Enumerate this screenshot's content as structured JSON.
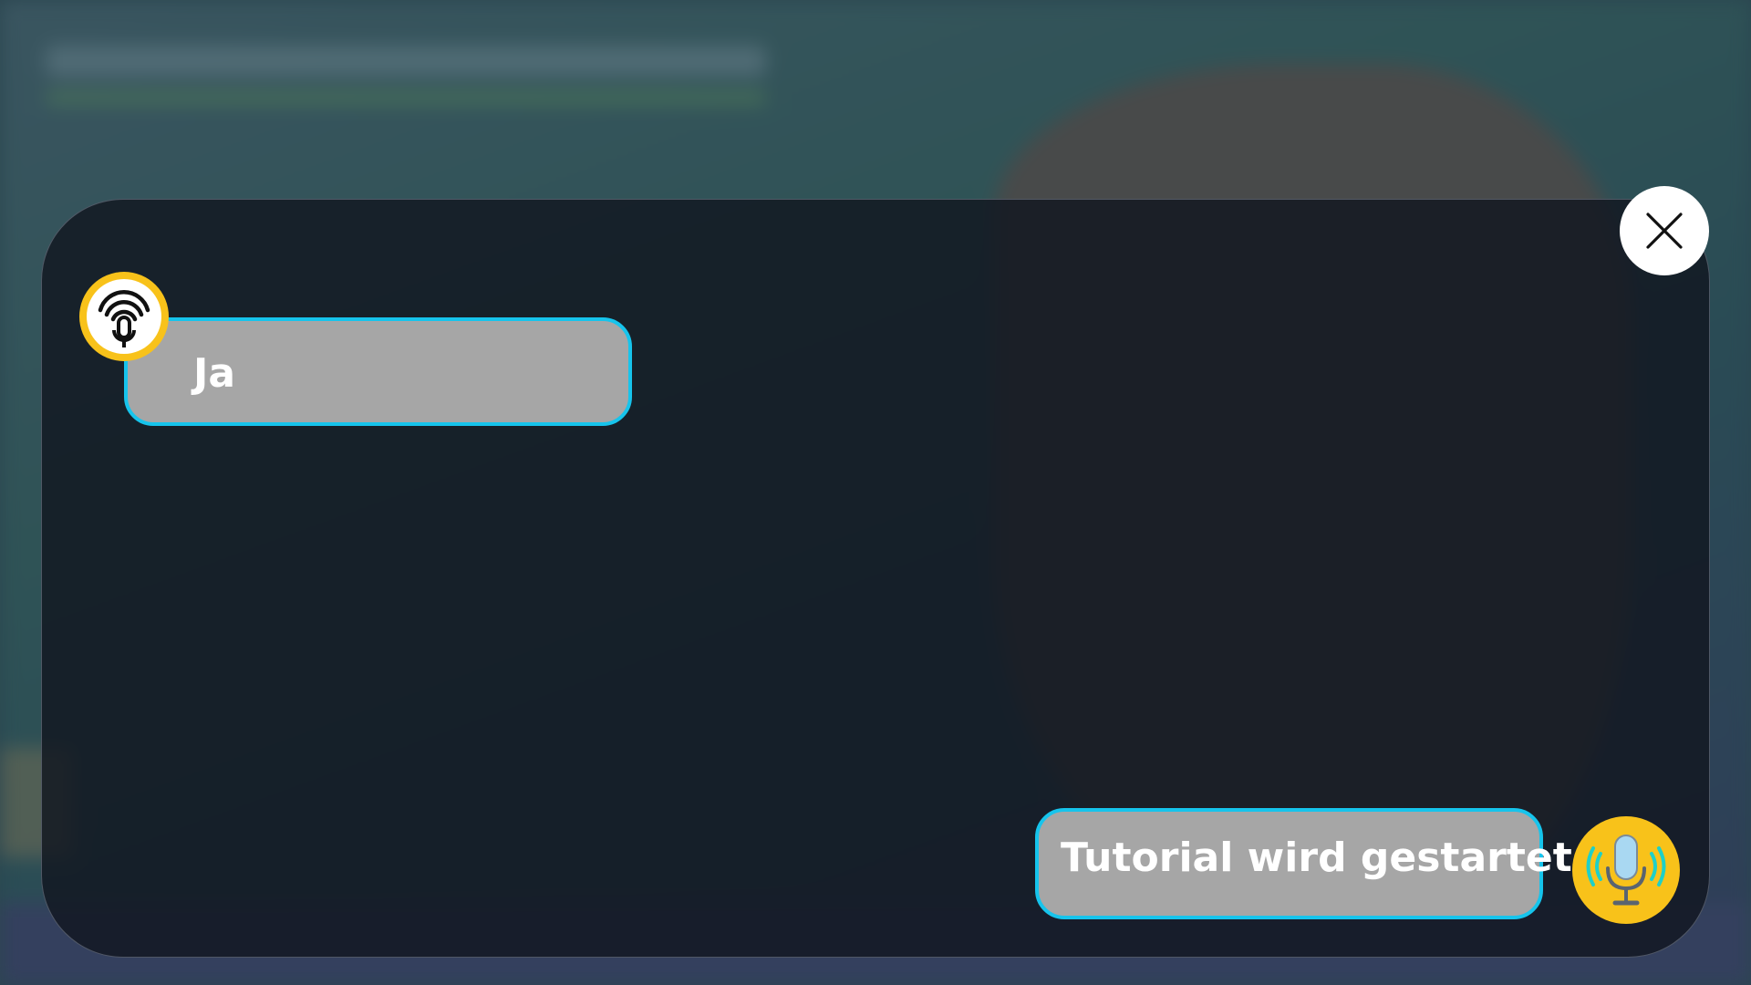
{
  "dialog": {
    "user_message": "Ja",
    "assistant_message": "Tutorial wird gestartet",
    "close_icon": "close-icon",
    "user_icon": "microphone-broadcast-icon",
    "assistant_icon": "microphone-speaking-icon"
  },
  "colors": {
    "accent_border": "#16c4ec",
    "bubble_fill": "#a6a6a6",
    "badge_yellow": "#f8c21a",
    "panel": "#11161f"
  }
}
